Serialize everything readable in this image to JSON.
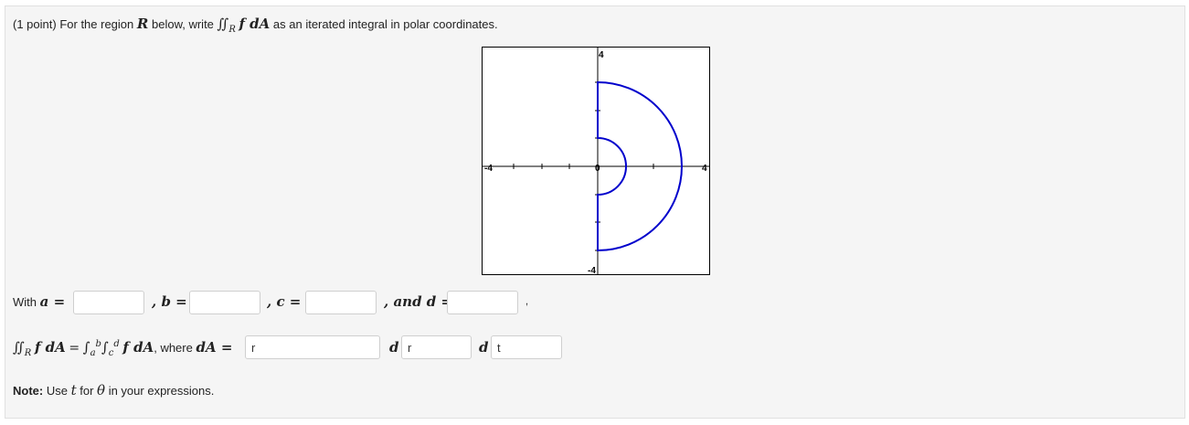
{
  "prompt": {
    "points": "(1 point)",
    "text_a": "For the region",
    "region": "R",
    "text_b": "below, write",
    "integrand": "f dA",
    "text_c": "as an iterated integral in polar coordinates."
  },
  "graph": {
    "x_min_label": "-4",
    "x_max_label": "4",
    "y_max_label": "4",
    "y_min_label": "-4",
    "origin_label": "0",
    "region_color": "#0000cc",
    "outer_radius": 3,
    "inner_radius": 1,
    "theta_range": [
      "-π/2",
      "π/2"
    ]
  },
  "bounds": {
    "with_label": "With",
    "a_label": "a =",
    "b_label": ", b =",
    "c_label": ", c =",
    "d_label": ", and d =",
    "trailing": ",",
    "a_value": "",
    "b_value": "",
    "c_value": "",
    "d_value": ""
  },
  "integral": {
    "where_label": ", where",
    "dA_label": "dA =",
    "d_symbol": "d",
    "field1_value": "r",
    "field2_value": "r",
    "field3_value": "t"
  },
  "note": {
    "bold": "Note:",
    "text_a": "Use",
    "var_t": "t",
    "text_b": "for",
    "var_theta": "θ",
    "text_c": "in your expressions."
  }
}
